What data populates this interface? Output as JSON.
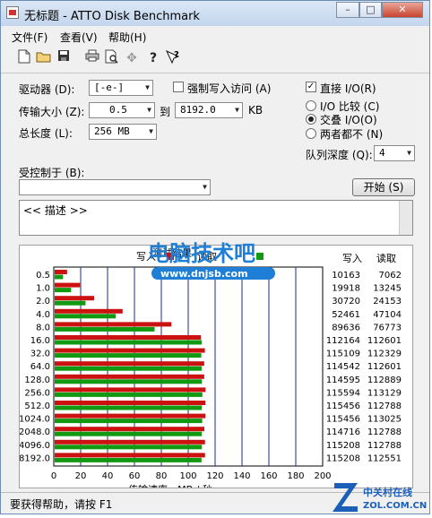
{
  "window": {
    "title": "无标题 - ATTO Disk Benchmark",
    "controls": {
      "minimize": "–",
      "maximize": "□",
      "close": "✕"
    }
  },
  "menu": {
    "file": "文件(F)",
    "view": "查看(V)",
    "help": "帮助(H)"
  },
  "toolbar": {
    "icons": [
      "new-file-icon",
      "open-folder-icon",
      "save-icon",
      "print-icon",
      "print-preview-icon",
      "move-icon",
      "help-icon",
      "context-help-icon"
    ]
  },
  "form": {
    "drive_label": "驱动器 (D):",
    "drive_value": "[-e-]",
    "force_write_label": "强制写入访问 (A)",
    "direct_io_label": "直接 I/O(R)",
    "transfer_label": "传输大小 (Z):",
    "transfer_from": "0.5",
    "transfer_to_label": "到",
    "transfer_to": "8192.0",
    "transfer_unit": "KB",
    "total_label": "总长度 (L):",
    "total_value": "256 MB",
    "io_compare": "I/O 比较 (C)",
    "overlap_io": "交叠 I/O(O)",
    "neither": "两者都不 (N)",
    "queue_label": "队列深度 (Q):",
    "queue_value": "4",
    "controlled_by_label": "受控制于 (B):",
    "controlled_by_value": "",
    "start_button": "开始 (S)",
    "description": "<< 描述 >>"
  },
  "chart_data": {
    "type": "bar",
    "title": "测试结果",
    "xlabel": "传输速率 - MB / 秒",
    "legend": {
      "write": "写入",
      "read": "读取"
    },
    "xlim": [
      0,
      200
    ],
    "xticks": [
      "0",
      "20",
      "40",
      "60",
      "80",
      "100",
      "120",
      "140",
      "160",
      "180",
      "200"
    ],
    "column_headers": {
      "write": "写入",
      "read": "读取"
    },
    "colors": {
      "write": "#cc1111",
      "read": "#119911"
    },
    "categories": [
      "0.5",
      "1.0",
      "2.0",
      "4.0",
      "8.0",
      "16.0",
      "32.0",
      "64.0",
      "128.0",
      "256.0",
      "512.0",
      "1024.0",
      "2048.0",
      "4096.0",
      "8192.0"
    ],
    "write_kb": [
      "10163",
      "19918",
      "30720",
      "52461",
      "89636",
      "112164",
      "115109",
      "114542",
      "114595",
      "115594",
      "115456",
      "115456",
      "114716",
      "115208",
      "115208"
    ],
    "read_kb": [
      "7062",
      "13245",
      "24153",
      "47104",
      "76773",
      "112601",
      "112329",
      "112601",
      "112889",
      "113129",
      "112788",
      "113025",
      "112788",
      "112788",
      "112551"
    ],
    "series": [
      {
        "name": "写入",
        "values": [
          9.9,
          19.5,
          30.0,
          51.2,
          87.5,
          109.5,
          112.4,
          111.9,
          111.9,
          112.9,
          112.8,
          112.8,
          112.0,
          112.5,
          112.5
        ]
      },
      {
        "name": "读取",
        "values": [
          6.9,
          12.9,
          23.6,
          46.0,
          75.0,
          110.0,
          109.7,
          110.0,
          110.2,
          110.5,
          110.1,
          110.4,
          110.1,
          110.1,
          109.9
        ]
      }
    ]
  },
  "watermark": {
    "text_cn": "电脑技术吧",
    "text_url": "www.dnjsb.com"
  },
  "status": {
    "text": "要获得帮助，请按 F1"
  },
  "brand": {
    "name": "中关村在线",
    "domain": "ZOL.COM.CN"
  }
}
